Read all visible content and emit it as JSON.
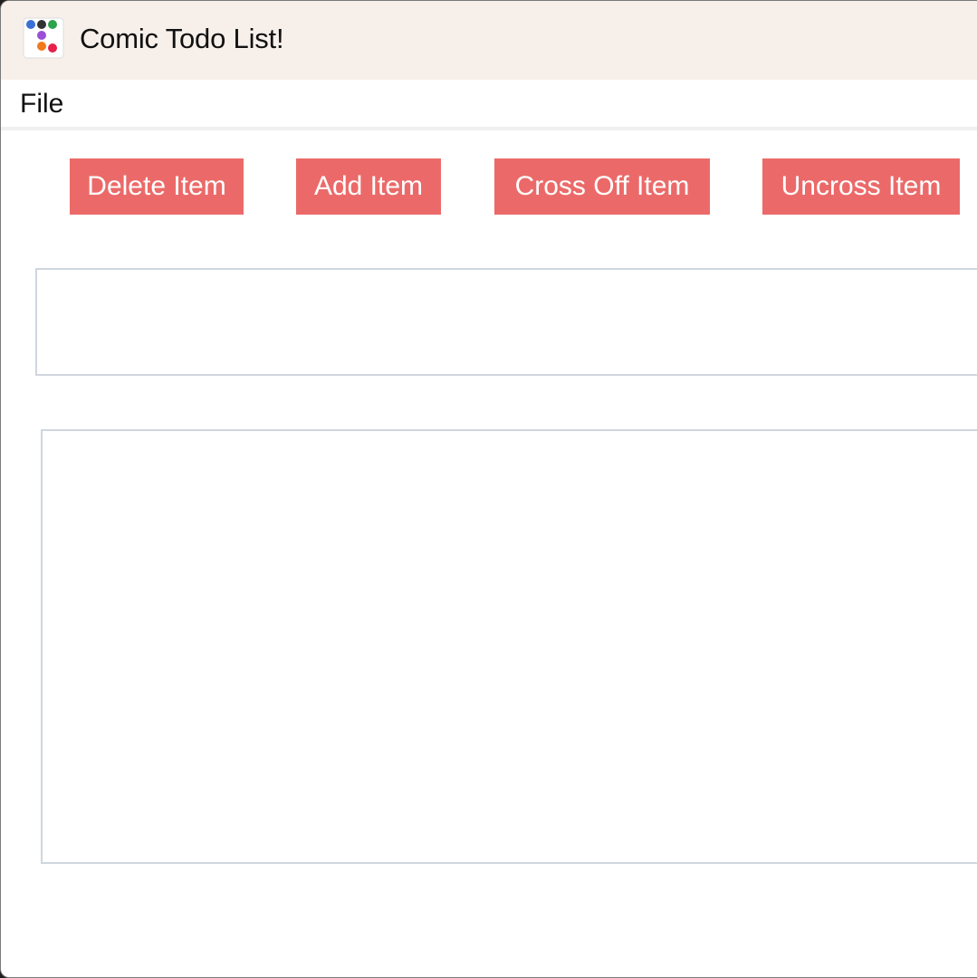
{
  "window": {
    "title": "Comic Todo List!",
    "icon": "app-dots-icon"
  },
  "menu": {
    "file_label": "File"
  },
  "toolbar": {
    "delete_label": "Delete Item",
    "add_label": "Add Item",
    "cross_label": "Cross Off Item",
    "uncross_label": "Uncross Item",
    "button_color": "#eb6a69"
  },
  "entry": {
    "value": "",
    "placeholder": ""
  },
  "list": {
    "items": []
  }
}
